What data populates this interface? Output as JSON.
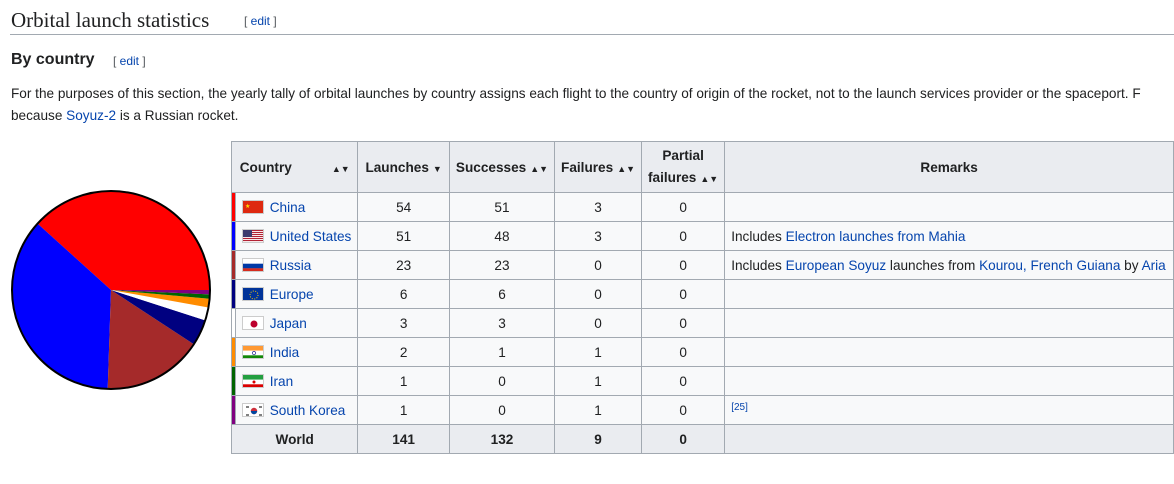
{
  "heading": {
    "title": "Orbital launch statistics",
    "edit": "edit"
  },
  "subheading": {
    "title": "By country",
    "edit": "edit"
  },
  "paragraph": {
    "text1": "For the purposes of this section, the yearly tally of orbital launches by country assigns each flight to the country of origin of the rocket, not to the launch services provider or the spaceport. F",
    "text2a": "because ",
    "link": "Soyuz-2",
    "text2b": " is a Russian rocket."
  },
  "table": {
    "headers": {
      "country": "Country",
      "launches": "Launches",
      "successes": "Successes",
      "failures": "Failures",
      "partial1": "Partial",
      "partial2": "failures",
      "remarks": "Remarks"
    },
    "rows": [
      {
        "country": "China",
        "flag": "china",
        "color": "#ff0000",
        "launches": "54",
        "successes": "51",
        "failures": "3",
        "partial": "0"
      },
      {
        "country": "United States",
        "flag": "usa",
        "color": "#0000ff",
        "launches": "51",
        "successes": "48",
        "failures": "3",
        "partial": "0",
        "remark_pre": "Includes ",
        "remark_link": "Electron launches from Mahia"
      },
      {
        "country": "Russia",
        "flag": "russia",
        "color": "#a52a2a",
        "launches": "23",
        "successes": "23",
        "failures": "0",
        "partial": "0",
        "remark_pre": "Includes ",
        "remark_link": "European Soyuz",
        "remark_mid": " launches from ",
        "remark_link2": "Kourou, French Guiana",
        "remark_post": " by ",
        "remark_link3": "Aria"
      },
      {
        "country": "Europe",
        "flag": "europe",
        "color": "#000080",
        "launches": "6",
        "successes": "6",
        "failures": "0",
        "partial": "0"
      },
      {
        "country": "Japan",
        "flag": "japan",
        "color": "#ffffff",
        "launches": "3",
        "successes": "3",
        "failures": "0",
        "partial": "0"
      },
      {
        "country": "India",
        "flag": "india",
        "color": "#ff8c00",
        "launches": "2",
        "successes": "1",
        "failures": "1",
        "partial": "0"
      },
      {
        "country": "Iran",
        "flag": "iran",
        "color": "#006400",
        "launches": "1",
        "successes": "0",
        "failures": "1",
        "partial": "0"
      },
      {
        "country": "South Korea",
        "flag": "korea",
        "color": "#800080",
        "launches": "1",
        "successes": "0",
        "failures": "1",
        "partial": "0",
        "remark_ref": "[25]"
      }
    ],
    "total": {
      "label": "World",
      "launches": "141",
      "successes": "132",
      "failures": "9",
      "partial": "0"
    }
  }
}
